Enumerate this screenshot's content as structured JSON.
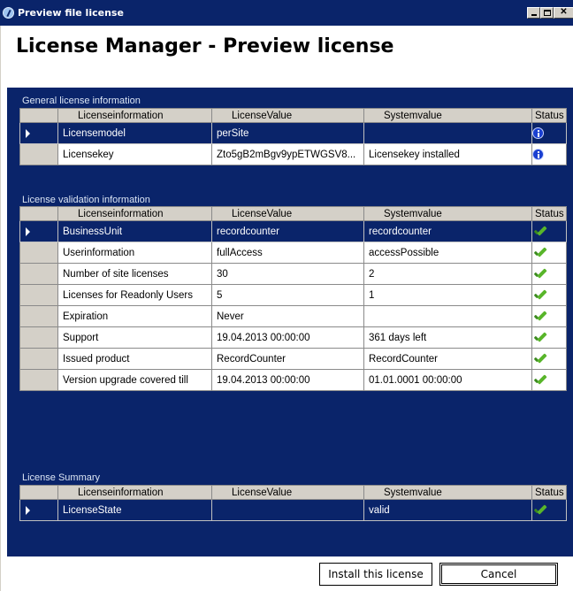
{
  "window": {
    "title": "Preview file license",
    "app_icon": "license-app-icon",
    "controls": [
      "minimize",
      "maximize",
      "close"
    ]
  },
  "page": {
    "title": "License Manager - Preview license"
  },
  "columns": {
    "info": "Licenseinformation",
    "value": "LicenseValue",
    "system": "Systemvalue",
    "status": "Status"
  },
  "sections": {
    "general": {
      "label": "General license information",
      "rows": [
        {
          "info": "Licensemodel",
          "value": "perSite",
          "system": "",
          "status": "info-icon",
          "selected": true
        },
        {
          "info": "Licensekey",
          "value": "Zto5gB2mBgv9ypETWGSV8...",
          "system": "Licensekey installed",
          "status": "info-icon",
          "selected": false
        }
      ]
    },
    "validation": {
      "label": "License validation information",
      "rows": [
        {
          "info": "BusinessUnit",
          "value": "recordcounter",
          "system": "recordcounter",
          "status": "check-icon",
          "selected": true
        },
        {
          "info": "Userinformation",
          "value": "fullAccess",
          "system": "accessPossible",
          "status": "check-icon",
          "selected": false
        },
        {
          "info": "Number of site licenses",
          "value": "30",
          "system": "2",
          "status": "check-icon",
          "selected": false
        },
        {
          "info": "Licenses for Readonly Users",
          "value": "5",
          "system": "1",
          "status": "check-icon",
          "selected": false
        },
        {
          "info": "Expiration",
          "value": "Never",
          "system": "",
          "status": "check-icon",
          "selected": false
        },
        {
          "info": "Support",
          "value": "19.04.2013 00:00:00",
          "system": "361 days left",
          "status": "check-icon",
          "selected": false
        },
        {
          "info": "Issued product",
          "value": "RecordCounter",
          "system": "RecordCounter",
          "status": "check-icon",
          "selected": false
        },
        {
          "info": "Version upgrade covered till",
          "value": "19.04.2013 00:00:00",
          "system": "01.01.0001 00:00:00",
          "status": "check-icon",
          "selected": false
        }
      ]
    },
    "summary": {
      "label": "License Summary",
      "rows": [
        {
          "info": "LicenseState",
          "value": "",
          "system": "valid",
          "status": "check-icon",
          "selected": true
        }
      ]
    }
  },
  "buttons": {
    "install": "Install this license",
    "cancel": "Cancel"
  },
  "colors": {
    "panel_background": "#0a246a",
    "selection": "#0a246a",
    "header_background": "#d4d0c8",
    "check_green": "#58b52a",
    "info_blue": "#1a3fd0"
  }
}
